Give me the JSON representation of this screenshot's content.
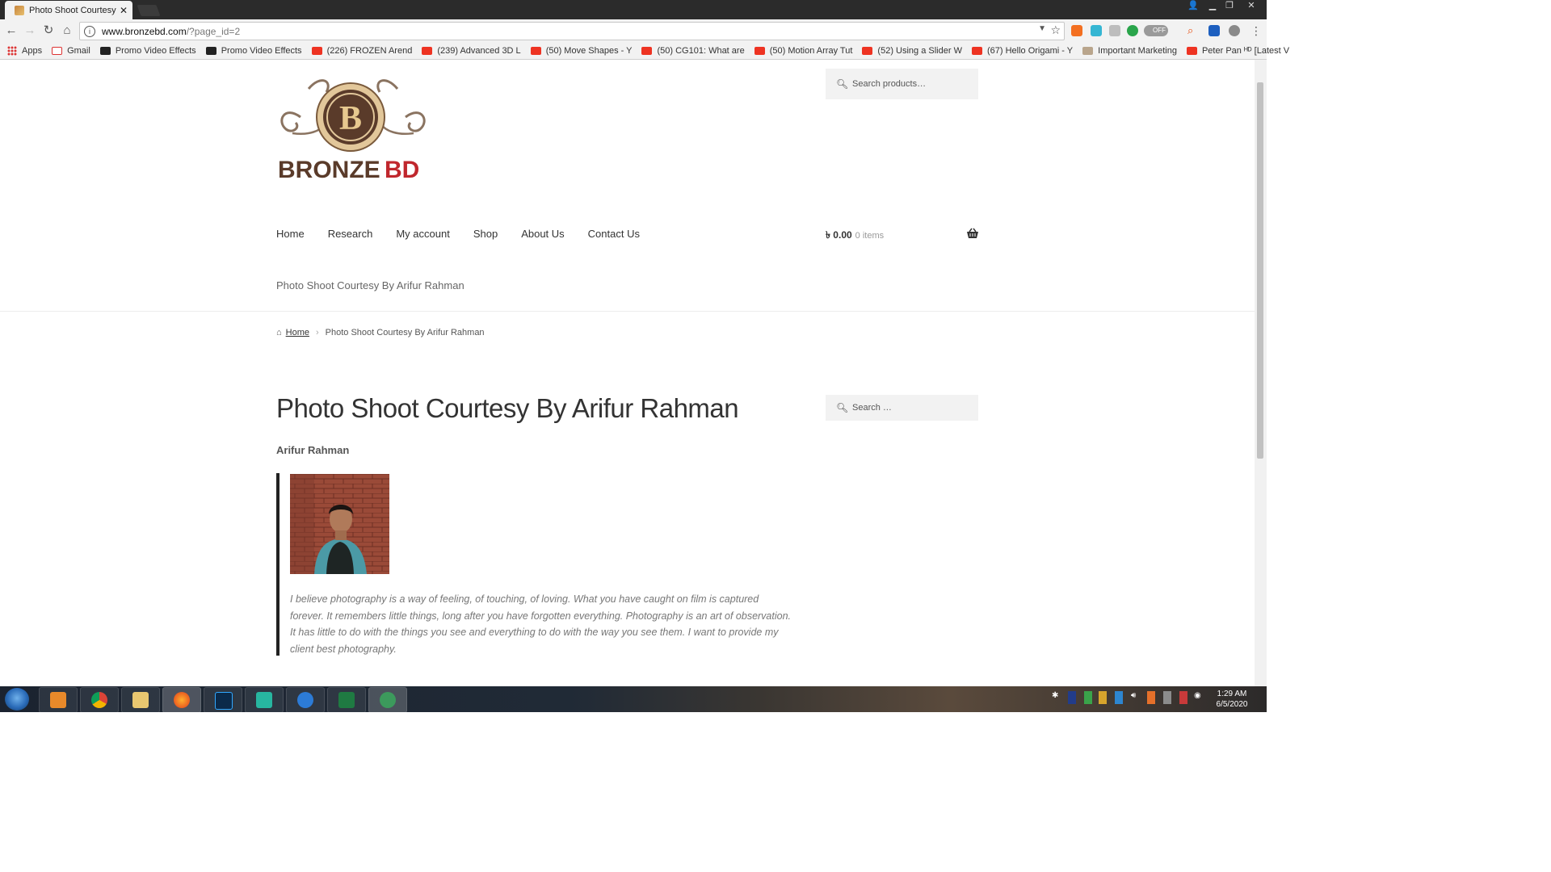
{
  "browser": {
    "tab_title": "Photo Shoot Courtesy By",
    "url_host": "www.bronzebd.com",
    "url_path": "/?page_id=2",
    "extension_toggle": "OFF"
  },
  "bookmarks": [
    {
      "label": "Apps",
      "icon": "apps-grid-icon"
    },
    {
      "label": "Gmail",
      "icon": "gmail-icon"
    },
    {
      "label": "Promo Video Effects",
      "icon": "promo-icon"
    },
    {
      "label": "Promo Video Effects",
      "icon": "promo-icon"
    },
    {
      "label": "(226) FROZEN Arend",
      "icon": "youtube-icon"
    },
    {
      "label": "(239) Advanced 3D L",
      "icon": "youtube-icon"
    },
    {
      "label": "(50) Move Shapes - Y",
      "icon": "youtube-icon"
    },
    {
      "label": "(50) CG101: What are",
      "icon": "youtube-icon"
    },
    {
      "label": "(50) Motion Array Tut",
      "icon": "youtube-icon"
    },
    {
      "label": "(52) Using a Slider W",
      "icon": "youtube-icon"
    },
    {
      "label": "(67) Hello Origami - Y",
      "icon": "youtube-icon"
    },
    {
      "label": "Important Marketing",
      "icon": "bookmark-icon"
    },
    {
      "label": "Peter Pan ᴴᴰ [Latest V",
      "icon": "youtube-icon"
    }
  ],
  "site": {
    "search_products_placeholder": "Search products…",
    "nav": [
      "Home",
      "Research",
      "My account",
      "Shop",
      "About Us",
      "Contact Us"
    ],
    "cart_amount": "৳ 0.00",
    "cart_items": "0 items",
    "subnav": "Photo Shoot Courtesy By Arifur Rahman",
    "breadcrumb_home": "Home",
    "breadcrumb_current": "Photo Shoot Courtesy By Arifur Rahman",
    "page_title": "Photo Shoot Courtesy By Arifur Rahman",
    "author": "Arifur Rahman",
    "quote": "I believe photography is a way of feeling, of touching, of loving. What you have caught on film is captured forever. It remembers little things, long after you have forgotten everything. Photography is an art of observation. It has little to do with the things you see and everything to do with the way you see them. I want to provide my client best photography.",
    "sidebar_search_placeholder": "Search …",
    "logo_text_dark": "BRONZE",
    "logo_text_accent": "BD",
    "logo_letter": "B"
  },
  "taskbar": {
    "time": "1:29 AM",
    "date": "6/5/2020"
  },
  "colors": {
    "logo_brown": "#5a3b2a",
    "logo_red": "#c0272d",
    "logo_green": "#2d7d3a",
    "text_dark": "#333333"
  }
}
